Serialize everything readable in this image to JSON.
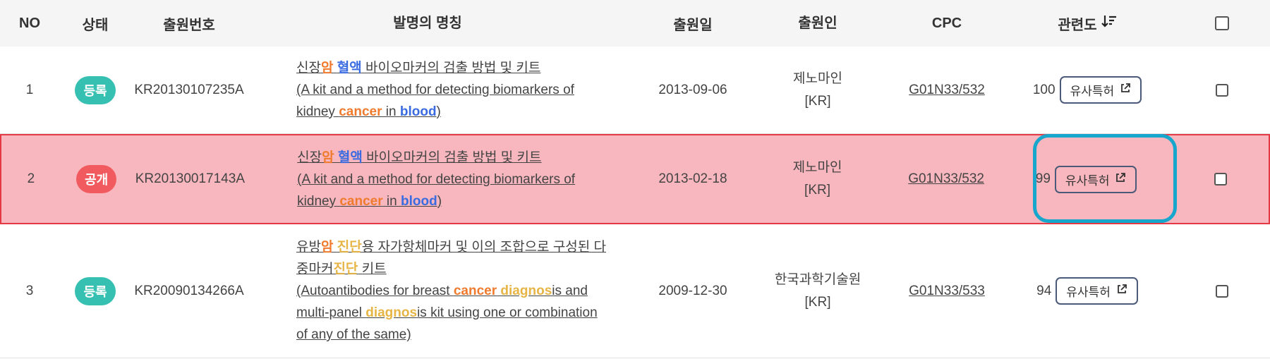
{
  "header": {
    "no": "NO",
    "status": "상태",
    "app_no": "출원번호",
    "title": "발명의 명칭",
    "app_date": "출원일",
    "applicant": "출원인",
    "cpc": "CPC",
    "relevance": "관련도"
  },
  "rows": [
    {
      "no": "1",
      "status": "등록",
      "app_no": "KR20130107235A",
      "title_ko_a": "신장",
      "title_ko_b": "암",
      "title_ko_c": " ",
      "title_ko_d": "혈액",
      "title_ko_e": " 바이오마커의 검출 방법 및 키트",
      "title_en_a": "(A kit and a method for detecting biomarkers of kidney ",
      "title_en_b": "cancer",
      "title_en_c": " in ",
      "title_en_d": "blood",
      "title_en_e": ")",
      "date": "2013-09-06",
      "applicant_name": "제노마인",
      "applicant_country": "[KR]",
      "cpc": "G01N33/532",
      "relevance": "100",
      "similar_label": "유사특허"
    },
    {
      "no": "2",
      "status": "공개",
      "app_no": "KR20130017143A",
      "title_ko_a": "신장",
      "title_ko_b": "암",
      "title_ko_c": " ",
      "title_ko_d": "혈액",
      "title_ko_e": " 바이오마커의 검출 방법 및 키트",
      "title_en_a": "(A kit and a method for detecting biomarkers of kidney ",
      "title_en_b": "cancer",
      "title_en_c": " in ",
      "title_en_d": "blood",
      "title_en_e": ")",
      "date": "2013-02-18",
      "applicant_name": "제노마인",
      "applicant_country": "[KR]",
      "cpc": "G01N33/532",
      "relevance": "99",
      "similar_label": "유사특허"
    },
    {
      "no": "3",
      "status": "등록",
      "app_no": "KR20090134266A",
      "title_ko_a": "유방",
      "title_ko_b": "암",
      "title_ko_c": " ",
      "title_ko_d": "진단",
      "title_ko_e": "용 자가항체마커 및 이의 조합으로 구성된 다중마커",
      "title_ko_f": "진단",
      "title_ko_g": " 키트",
      "title_en_a": "(Autoantibodies for breast ",
      "title_en_b": "cancer",
      "title_en_c": " ",
      "title_en_d": "diagnos",
      "title_en_e": "is and multi-panel ",
      "title_en_f": "diagnos",
      "title_en_g": "is kit using one or combination of any of the same)",
      "date": "2009-12-30",
      "applicant_name": "한국과학기술원",
      "applicant_country": "[KR]",
      "cpc": "G01N33/533",
      "relevance": "94",
      "similar_label": "유사특허"
    }
  ],
  "icons": {
    "sort": "sort-descending-icon",
    "external_link": "external-link-icon"
  },
  "colors": {
    "registered_badge": "#36c0b2",
    "published_badge": "#f15b5f",
    "highlight_row_bg": "#f8b7be",
    "highlight_row_border": "#e53a45",
    "cancer_highlight": "#f07b2e",
    "blood_highlight": "#3a6be0",
    "diagnosis_highlight": "#e6b545",
    "focus_ring": "#18a7cc"
  }
}
